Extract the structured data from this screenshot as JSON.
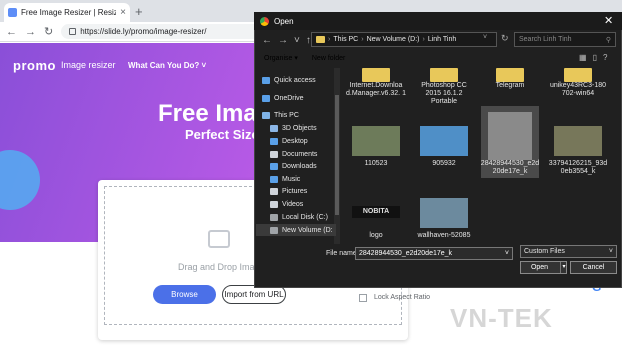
{
  "browser": {
    "tab_title": "Free Image Resizer | Resize Your I",
    "new_tab": "+",
    "url": "https://slide.ly/promo/image-resizer/"
  },
  "page": {
    "logo": "promo",
    "logo_sub": "Image resizer",
    "nav_what": "What Can You Do? ˅",
    "headline": "Free Imag",
    "subhead": "Perfect Size",
    "drag_text": "Drag and Drop Imag",
    "browse": "Browse",
    "import_url": "Import from URL",
    "lock_aspect": "Lock Aspect Ratio",
    "google": "G",
    "watermark": "VN-TEK"
  },
  "dialog": {
    "title": "Open",
    "close": "✕",
    "address": [
      "This PC",
      "New Volume (D:)",
      "Linh Tinh"
    ],
    "search_placeholder": "Search Linh Tinh",
    "organise": "Organise ▾",
    "new_folder": "New folder",
    "nav": [
      {
        "label": "Quick access",
        "color": "#5aa0e8"
      },
      {
        "label": "OneDrive",
        "color": "#5aa0e8"
      },
      {
        "label": "This PC",
        "color": "#7fb2e5"
      },
      {
        "label": "3D Objects",
        "color": "#8bb6e6"
      },
      {
        "label": "Desktop",
        "color": "#5aa0e8"
      },
      {
        "label": "Documents",
        "color": "#cfd4da"
      },
      {
        "label": "Downloads",
        "color": "#5aa0e8"
      },
      {
        "label": "Music",
        "color": "#5aa0e8"
      },
      {
        "label": "Pictures",
        "color": "#cfd4da"
      },
      {
        "label": "Videos",
        "color": "#cfd4da"
      },
      {
        "label": "Local Disk (C:)",
        "color": "#a0a4a8"
      },
      {
        "label": "New Volume (D:",
        "color": "#a0a4a8"
      }
    ],
    "files": [
      {
        "name": "Internet.Downloa d.Manager.v6.32. 1",
        "kind": "folder"
      },
      {
        "name": "Photoshop CC 2015 16.1.2 Portable",
        "kind": "folder"
      },
      {
        "name": "Telegram",
        "kind": "folder"
      },
      {
        "name": "unikey43RC3-180 702-win64",
        "kind": "folder"
      },
      {
        "name": "110523",
        "kind": "image",
        "color": "#6d7b5a"
      },
      {
        "name": "905932",
        "kind": "image",
        "color": "#4f8fc7"
      },
      {
        "name": "28428944530_e2d 20de17e_k",
        "kind": "image",
        "color": "#8a8a8a"
      },
      {
        "name": "33794126215_93d 0eb3554_k",
        "kind": "image",
        "color": "#77775a"
      },
      {
        "name": "logo",
        "kind": "image",
        "color": "#111111"
      },
      {
        "name": "wallhaven-52085",
        "kind": "image",
        "color": "#6c8a9e"
      }
    ],
    "logo_thumb_text": "NOBITA",
    "filename_label": "File name:",
    "filename_value": "28428944530_e2d20de17e_k",
    "filetype": "Custom Files",
    "open": "Open",
    "cancel": "Cancel"
  }
}
